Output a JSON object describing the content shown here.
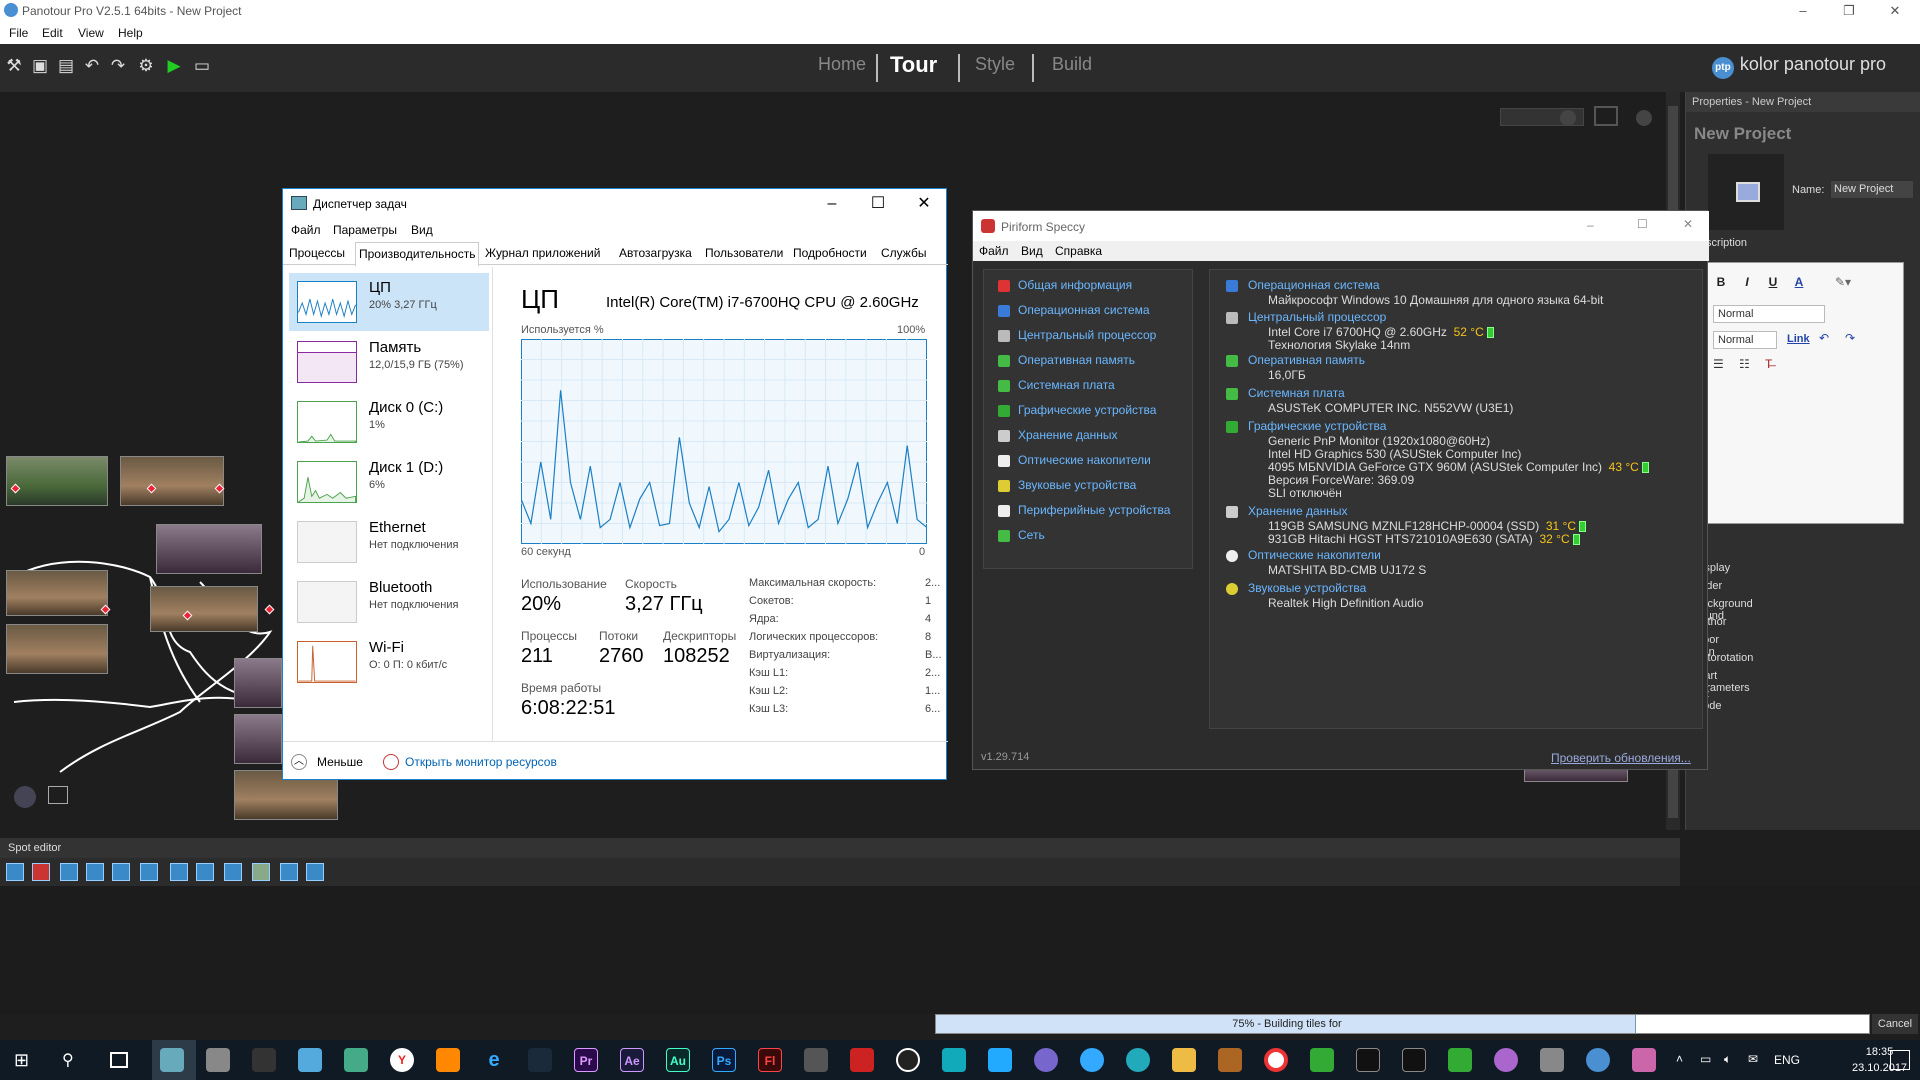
{
  "panotour": {
    "window_title": "Panotour Pro V2.5.1 64bits - New Project",
    "menu": [
      "File",
      "Edit",
      "View",
      "Help"
    ],
    "nav": [
      "Home",
      "Tour",
      "Style",
      "Build"
    ],
    "nav_active": "Tour",
    "logo_badge": "ptp",
    "logo_text": "kolor panotour pro",
    "properties": {
      "header": "Properties - New Project",
      "project_name": "New Project",
      "name_label": "Name:",
      "name_value": "New Project",
      "description_label": "Description",
      "editor": {
        "bold": "B",
        "italic": "I",
        "underline": "U",
        "color": "A",
        "format_select": "Normal",
        "size_select": "Normal",
        "link": "Link"
      },
      "items": [
        "Display",
        "Order",
        "Background sound",
        "Author",
        "Floor plan",
        "Autorotation",
        "Start parameters",
        "VR Mode"
      ]
    },
    "spot_editor": "Spot editor",
    "progress": {
      "value": 0.75,
      "text": "75% - Building tiles for"
    },
    "cancel": "Cancel"
  },
  "taskmanager": {
    "title": "Диспетчер задач",
    "menu": [
      "Файл",
      "Параметры",
      "Вид"
    ],
    "tabs": [
      "Процессы",
      "Производительность",
      "Журнал приложений",
      "Автозагрузка",
      "Пользователи",
      "Подробности",
      "Службы"
    ],
    "active_tab": "Производительность",
    "resources": [
      {
        "name": "ЦП",
        "value": "20% 3,27 ГГц"
      },
      {
        "name": "Память",
        "value": "12,0/15,9 ГБ (75%)"
      },
      {
        "name": "Диск 0 (C:)",
        "value": "1%"
      },
      {
        "name": "Диск 1 (D:)",
        "value": "6%"
      },
      {
        "name": "Ethernet",
        "value": "Нет подключения"
      },
      {
        "name": "Bluetooth",
        "value": "Нет подключения"
      },
      {
        "name": "Wi-Fi",
        "value": "О: 0 П: 0 кбит/с"
      }
    ],
    "cpu": {
      "heading": "ЦП",
      "model": "Intel(R) Core(TM) i7-6700HQ CPU @ 2.60GHz",
      "graph_label": "Используется %",
      "graph_max": "100%",
      "x_left": "60 секунд",
      "x_right": "0",
      "stats": {
        "usage_label": "Использование",
        "usage": "20%",
        "speed_label": "Скорость",
        "speed": "3,27 ГГц",
        "proc_label": "Процессы",
        "proc": "211",
        "threads_label": "Потоки",
        "threads": "2760",
        "handles_label": "Дескрипторы",
        "handles": "108252",
        "uptime_label": "Время работы",
        "uptime": "6:08:22:51"
      },
      "details": [
        {
          "k": "Максимальная скорость:",
          "v": "2..."
        },
        {
          "k": "Сокетов:",
          "v": "1"
        },
        {
          "k": "Ядра:",
          "v": "4"
        },
        {
          "k": "Логических процессоров:",
          "v": "8"
        },
        {
          "k": "Виртуализация:",
          "v": "В..."
        },
        {
          "k": "Кэш L1:",
          "v": "2..."
        },
        {
          "k": "Кэш L2:",
          "v": "1..."
        },
        {
          "k": "Кэш L3:",
          "v": "6..."
        }
      ],
      "usage_series": [
        22,
        10,
        40,
        12,
        75,
        30,
        12,
        38,
        8,
        12,
        30,
        8,
        22,
        30,
        9,
        10,
        52,
        20,
        8,
        28,
        6,
        12,
        30,
        9,
        18,
        36,
        10,
        22,
        30,
        8,
        12,
        38,
        10,
        22,
        40,
        8,
        20,
        30,
        10,
        48,
        12,
        8
      ]
    },
    "less_label": "Меньше",
    "monitor_link": "Открыть монитор ресурсов"
  },
  "speccy": {
    "title": "Piriform Speccy",
    "menu": [
      "Файл",
      "Вид",
      "Справка"
    ],
    "nav": [
      {
        "label": "Общая информация",
        "color": "#d33"
      },
      {
        "label": "Операционная система",
        "color": "#3a7ad8"
      },
      {
        "label": "Центральный процессор",
        "color": "#bbb"
      },
      {
        "label": "Оперативная память",
        "color": "#4b4"
      },
      {
        "label": "Системная плата",
        "color": "#4b4"
      },
      {
        "label": "Графические устройства",
        "color": "#3a3"
      },
      {
        "label": "Хранение данных",
        "color": "#ccc"
      },
      {
        "label": "Оптические накопители",
        "color": "#eee"
      },
      {
        "label": "Звуковые устройства",
        "color": "#dc3"
      },
      {
        "label": "Периферийные устройства",
        "color": "#eee"
      },
      {
        "label": "Сеть",
        "color": "#4b4"
      }
    ],
    "sections": [
      {
        "title": "Операционная система",
        "lines": [
          {
            "t": "Майкрософт Windows 10 Домашняя для одного языка 64-bit"
          }
        ]
      },
      {
        "title": "Центральный процессор",
        "lines": [
          {
            "t": "Intel Core i7 6700HQ @ 2.60GHz",
            "temp": "52 °C"
          },
          {
            "t": "Технология Skylake 14nm"
          }
        ]
      },
      {
        "title": "Оперативная память",
        "lines": [
          {
            "t": "16,0ГБ"
          }
        ]
      },
      {
        "title": "Системная плата",
        "lines": [
          {
            "t": "ASUSTeK COMPUTER INC. N552VW (U3E1)"
          }
        ]
      },
      {
        "title": "Графические устройства",
        "lines": [
          {
            "t": "Generic PnP Monitor (1920x1080@60Hz)"
          },
          {
            "t": "Intel HD Graphics 530 (ASUStek Computer Inc)"
          },
          {
            "t": "4095 МБNVIDIA GeForce GTX 960M (ASUStek Computer Inc)",
            "temp": "43 °C"
          },
          {
            "t": "Версия ForceWare: 369.09"
          },
          {
            "t": "SLI отключён"
          }
        ]
      },
      {
        "title": "Хранение данных",
        "lines": [
          {
            "t": "119GB SAMSUNG MZNLF128HCHP-00004 (SSD)",
            "temp": "31 °C"
          },
          {
            "t": "931GB Hitachi HGST HTS721010A9E630 (SATA)",
            "temp": "32 °C"
          }
        ]
      },
      {
        "title": "Оптические накопители",
        "lines": [
          {
            "t": "MATSHITA BD-CMB UJ172 S"
          }
        ]
      },
      {
        "title": "Звуковые устройства",
        "lines": [
          {
            "t": "Realtek High Definition Audio"
          }
        ]
      }
    ],
    "version": "v1.29.714",
    "update_link": "Проверить обновления..."
  },
  "taskbar": {
    "lang": "ENG",
    "time": "18:35",
    "date": "23.10.2017",
    "apps": [
      "Pr",
      "Ae",
      "Au",
      "Ps",
      "Fl"
    ]
  }
}
